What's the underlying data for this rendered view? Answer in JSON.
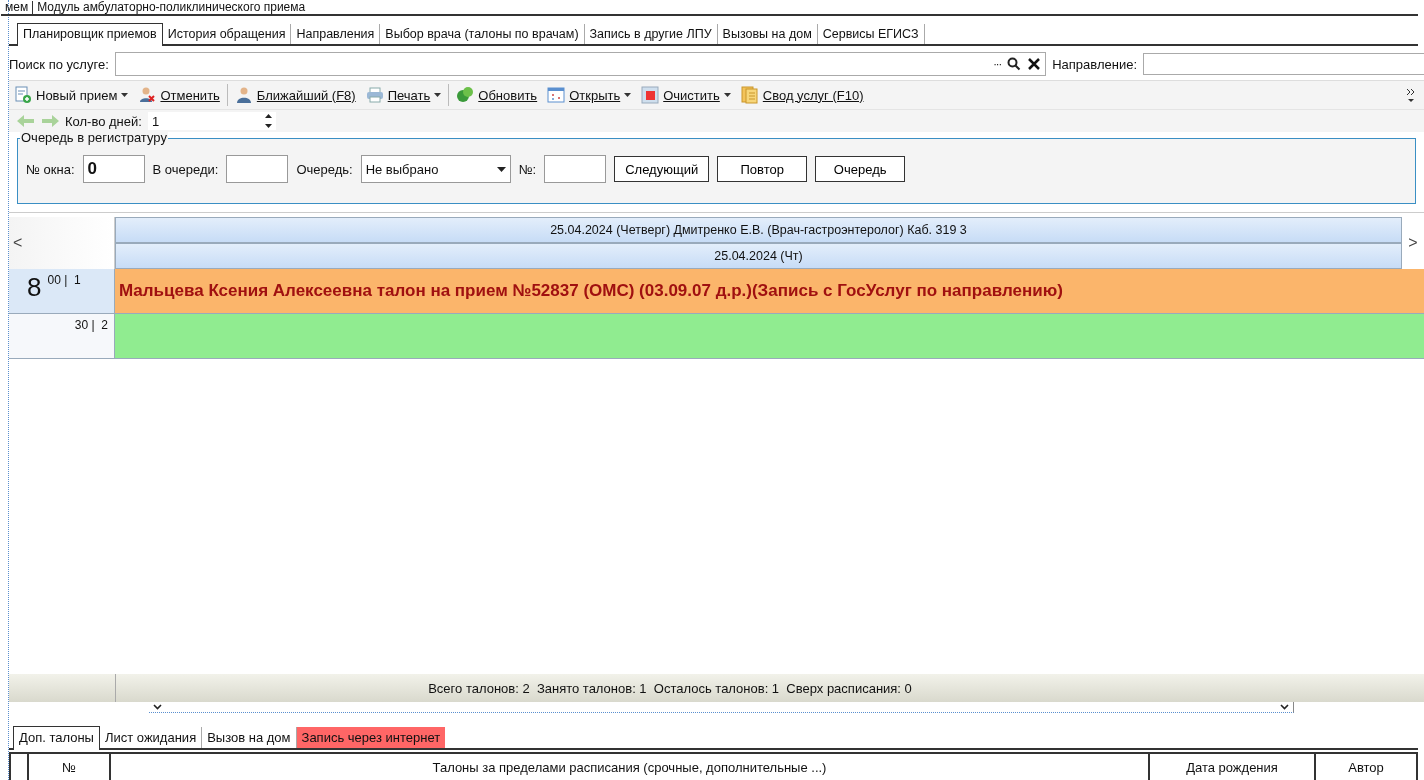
{
  "top_strip": {
    "items": [
      "мем",
      "Модуль амбулаторно-поликлинического приема"
    ]
  },
  "tabs": [
    {
      "label": "Планировщик приемов",
      "selected": true
    },
    {
      "label": "История обращения",
      "selected": false
    },
    {
      "label": "Направления",
      "selected": false
    },
    {
      "label": "Выбор врача (талоны по врачам)",
      "selected": false
    },
    {
      "label": "Запись в другие ЛПУ",
      "selected": false
    },
    {
      "label": "Вызовы на дом",
      "selected": false
    },
    {
      "label": "Сервисы ЕГИСЗ",
      "selected": false
    }
  ],
  "search": {
    "label": "Поиск по услуге:",
    "more": "···",
    "direction_label": "Направление:"
  },
  "toolbar": [
    {
      "label": "Новый прием",
      "kind": "dropdown"
    },
    {
      "label": "Отменить",
      "kind": "button"
    },
    {
      "label": "Ближайший (F8)",
      "kind": "button"
    },
    {
      "label": "Печать",
      "kind": "dropdown"
    },
    {
      "label": "Обновить",
      "kind": "button"
    },
    {
      "label": "Открыть",
      "kind": "dropdown"
    },
    {
      "label": "Очистить",
      "kind": "dropdown"
    },
    {
      "label": "Свод услуг (F10)",
      "kind": "button"
    }
  ],
  "days": {
    "label": "Кол-во дней:",
    "value": "1"
  },
  "queue": {
    "title": "Очередь в регистратуру",
    "window_label": "№ окна:",
    "window_value": "0",
    "in_queue_label": "В очереди:",
    "queue_label": "Очередь:",
    "queue_value": "Не выбрано",
    "number_label": "№:",
    "buttons": [
      "Следующий",
      "Повтор",
      "Очередь"
    ]
  },
  "schedule": {
    "nav_left": "<",
    "nav_right": ">",
    "header": "25.04.2024 (Четверг) Дмитренко Е.В. (Врач-гастроэнтеролог) Каб. 319 3",
    "subheader": "25.04.2024 (Чт)",
    "slots": [
      {
        "hour": "8",
        "time": "00 |  1",
        "text": "Мальцева Ксения Алексеевна талон на прием №52837 (ОМС) (03.09.07 д.р.)(Запись с ГосУслуг по направлению)",
        "color": "#fbb56b"
      },
      {
        "time": "30 |  2",
        "color": "#90ec90"
      }
    ],
    "summary": "Всего талонов: 2  Занято талонов: 1  Осталось талонов: 1  Сверх расписания: 0"
  },
  "bottom_tabs": [
    {
      "label": "Доп. талоны",
      "selected": true,
      "highlighted": false
    },
    {
      "label": "Лист ожидания",
      "selected": false,
      "highlighted": false
    },
    {
      "label": "Вызов на дом",
      "selected": false,
      "highlighted": false
    },
    {
      "label": "Запись через интернет",
      "selected": false,
      "highlighted": true
    }
  ],
  "extra_table": {
    "columns": [
      "№",
      "Талоны за пределами расписания (срочные, дополнительные ...)",
      "Дата рождения",
      "Автор"
    ]
  }
}
